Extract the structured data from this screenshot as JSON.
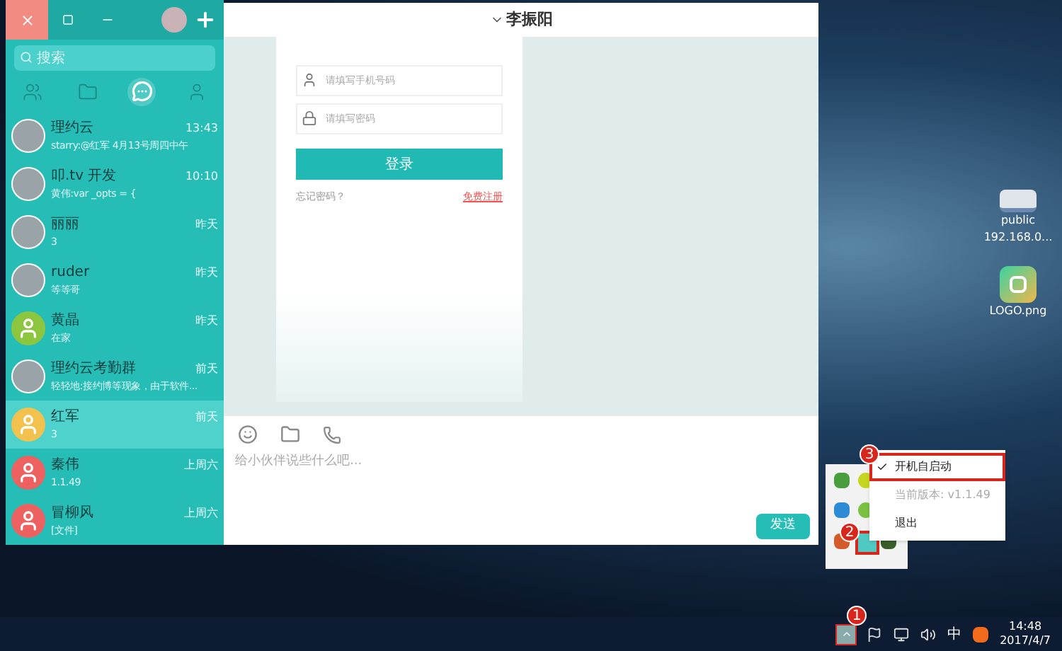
{
  "sidebar": {
    "search": {
      "placeholder": "搜索"
    },
    "tabs": [
      {
        "kind": "groups",
        "selected": false
      },
      {
        "kind": "files",
        "selected": false
      },
      {
        "kind": "chats",
        "selected": true
      },
      {
        "kind": "contacts",
        "selected": false
      }
    ],
    "conversations": [
      {
        "name": "理约云",
        "preview": "starry:@红军 4月13号周四中午",
        "time": "13:43",
        "kind": "photo",
        "selected": false
      },
      {
        "name": "叩.tv 开发",
        "preview": "黄伟:var _opts = {",
        "time": "10:10",
        "kind": "photo",
        "selected": false
      },
      {
        "name": "丽丽",
        "preview": "3",
        "time": "昨天",
        "kind": "photo",
        "selected": false
      },
      {
        "name": "ruder",
        "preview": "等等哥",
        "time": "昨天",
        "kind": "photo",
        "selected": false
      },
      {
        "name": "黄晶",
        "preview": "在家",
        "time": "昨天",
        "kind": "default",
        "color": "#8cc63f",
        "selected": false
      },
      {
        "name": "理约云考勤群",
        "preview": "轻轻地:接约博等现象，由于软件...",
        "time": "前天",
        "kind": "photo",
        "selected": false
      },
      {
        "name": "红军",
        "preview": "3",
        "time": "前天",
        "kind": "default",
        "color": "#f2c14e",
        "selected": true
      },
      {
        "name": "秦伟",
        "preview": "1.1.49",
        "time": "上周六",
        "kind": "default",
        "color": "#ee6161",
        "selected": false
      },
      {
        "name": "冒柳风",
        "preview": "[文件]",
        "time": "上周六",
        "kind": "default",
        "color": "#ee6161",
        "selected": false
      }
    ]
  },
  "chat": {
    "title": "李振阳",
    "login": {
      "phone_placeholder": "请填写手机号码",
      "password_placeholder": "请填写密码",
      "button": "登录",
      "forgot": "忘记密码？",
      "register": "免费注册"
    },
    "composer": {
      "placeholder": "给小伙伴说些什么吧...",
      "send": "发送"
    }
  },
  "desktop_icons": [
    {
      "kind": "network",
      "label": "public",
      "sublabel": "192.168.0..."
    },
    {
      "kind": "image",
      "label": "LOGO.png"
    }
  ],
  "tray_menu": [
    {
      "label": "开机自启动",
      "checked": true,
      "disabled": false
    },
    {
      "label": "当前版本: v1.1.49",
      "checked": false,
      "disabled": true
    },
    {
      "label": "退出",
      "checked": false,
      "disabled": false
    }
  ],
  "steps": [
    "1",
    "2",
    "3"
  ],
  "taskbar": {
    "ime": "中",
    "time": "14:48",
    "date": "2017/4/7"
  }
}
